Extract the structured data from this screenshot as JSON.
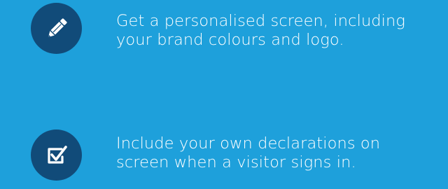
{
  "colors": {
    "background": "#1ea0db",
    "icon_circle": "#114b79",
    "text": "#ffffff"
  },
  "features": [
    {
      "icon": "pencil-icon",
      "line1": "Get a personalised screen, including",
      "line2": "your brand colours and logo."
    },
    {
      "icon": "checkbox-icon",
      "line1": "Include your own declarations on",
      "line2": "screen when a visitor signs in."
    }
  ]
}
